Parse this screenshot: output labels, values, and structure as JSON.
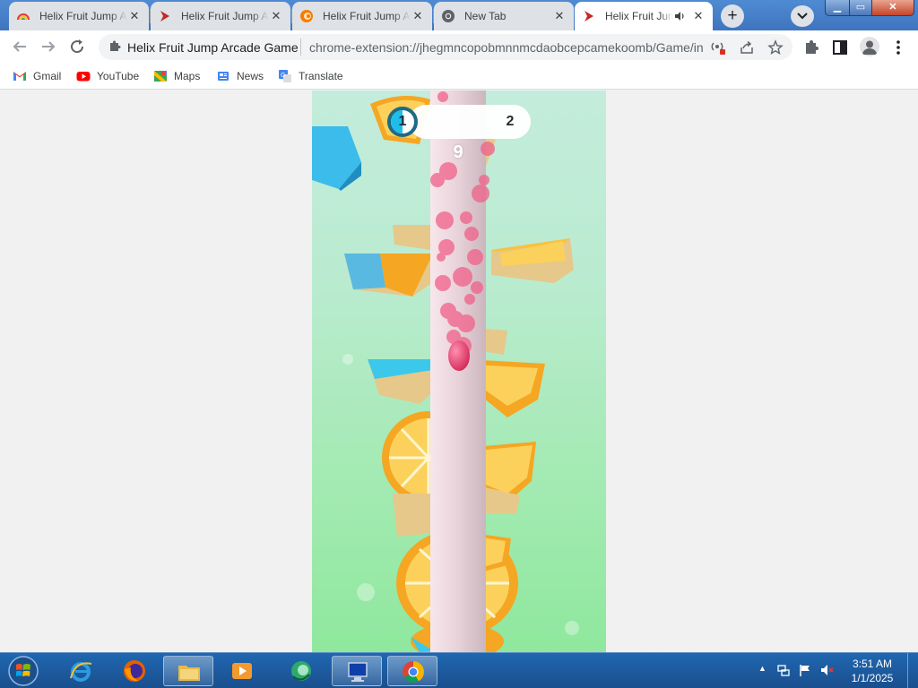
{
  "browser": {
    "tabs": [
      {
        "title": "Helix Fruit Jump Arcade Game",
        "icon": "rainbow-favicon",
        "active": false
      },
      {
        "title": "Helix Fruit Jump Arcade Game",
        "icon": "arrow-favicon",
        "active": false
      },
      {
        "title": "Helix Fruit Jump Arcade Game",
        "icon": "orange-swirl-favicon",
        "active": false
      },
      {
        "title": "New Tab",
        "icon": "chrome-favicon",
        "active": false
      },
      {
        "title": "Helix Fruit Jump Arcade Game",
        "icon": "arrow-favicon",
        "active": true,
        "audio": "speaker-icon"
      }
    ],
    "new_tab_label": "+",
    "tab_search_label": "⌄",
    "window_buttons": {
      "minimize": "▁",
      "maximize": "▭",
      "close": "✕"
    },
    "address": {
      "site_name": "Helix Fruit Jump Arcade Game",
      "url": "chrome-extension://jhegmncopobmnnmcdaobcepcamekoomb/Game/index.html"
    },
    "bookmarks": [
      {
        "label": "Gmail",
        "icon": "gmail-icon"
      },
      {
        "label": "YouTube",
        "icon": "youtube-icon"
      },
      {
        "label": "Maps",
        "icon": "maps-icon"
      },
      {
        "label": "News",
        "icon": "news-icon"
      },
      {
        "label": "Translate",
        "icon": "translate-icon"
      }
    ]
  },
  "game": {
    "current_level": "1",
    "next_level": "2",
    "level_progress": 0.5,
    "score": "9",
    "colors": {
      "orange": "#f7a81b",
      "pole": "#e9d6dc",
      "ball": "#e83a6b",
      "ice": "#3cc8ea",
      "sky_top": "#c4ecdc",
      "sky_bottom": "#8fe89d"
    }
  },
  "taskbar": {
    "apps": [
      {
        "name": "internet-explorer-icon",
        "open": false
      },
      {
        "name": "firefox-icon",
        "open": false
      },
      {
        "name": "file-explorer-icon",
        "open": true
      },
      {
        "name": "media-player-icon",
        "open": false
      },
      {
        "name": "media-center-icon",
        "open": false
      },
      {
        "name": "remote-desktop-icon",
        "open": true
      },
      {
        "name": "chrome-icon",
        "open": true
      }
    ],
    "clock": {
      "time": "3:51 AM",
      "date": "1/1/2025"
    }
  }
}
